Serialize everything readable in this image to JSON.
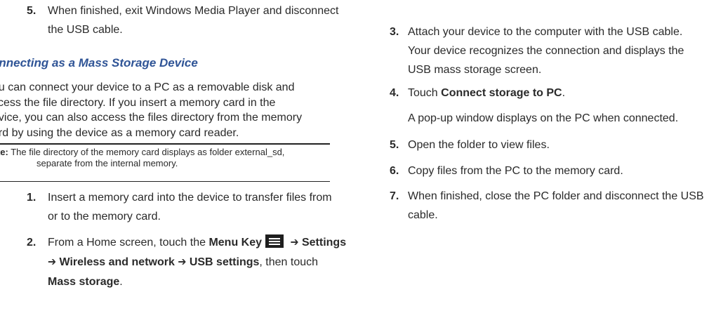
{
  "left": {
    "step5": {
      "num": "5.",
      "line1": "When finished, exit Windows Media Player and disconnect",
      "line2": "the USB cable."
    },
    "section_title": "onnecting as a Mass Storage Device",
    "paragraph": {
      "line1": "ou can connect your device to a PC as a removable disk and",
      "line2": "ccess the file directory. If you insert a memory card in the",
      "line3": "evice, you can also access the files directory from the memory",
      "line4": "ard by using the device as a memory card reader."
    },
    "note": {
      "label": "ote:",
      "line1": "The file directory of the memory card displays as folder external_sd,",
      "line2": "separate from the internal memory."
    },
    "step1": {
      "num": "1.",
      "line1": "Insert a memory card into the device to transfer files from",
      "line2": "or to the memory card."
    },
    "step2": {
      "num": "2.",
      "part1": "From a Home screen, touch the ",
      "menu_key": "Menu Key",
      "menu_icon": "menu-key-icon",
      "arrow1": " ➔ ",
      "settings": "Settings",
      "arrow2": "➔ ",
      "wireless": "Wireless and network",
      "arrow3": " ➔ ",
      "usb_settings": "USB settings",
      "then_touch": ", then touch",
      "mass_storage": "Mass storage",
      "period": "."
    }
  },
  "right": {
    "step3": {
      "num": "3.",
      "line1": "Attach your device to the computer with the USB cable.",
      "line2": "Your device recognizes the connection and displays the",
      "line3": "USB mass storage screen."
    },
    "step4": {
      "num": "4.",
      "touch": "Touch ",
      "connect": "Connect storage to PC",
      "period": ".",
      "subtext": "A pop-up window displays on the PC when connected."
    },
    "step5": {
      "num": "5.",
      "text": "Open the folder to view files."
    },
    "step6": {
      "num": "6.",
      "text": "Copy files from the PC to the memory card."
    },
    "step7": {
      "num": "7.",
      "line1": "When finished, close the PC folder and disconnect the USB",
      "line2": "cable."
    }
  },
  "colors": {
    "heading": "#2f5496",
    "text": "#2a2a2a",
    "icon_bg": "#1e1e1e"
  }
}
